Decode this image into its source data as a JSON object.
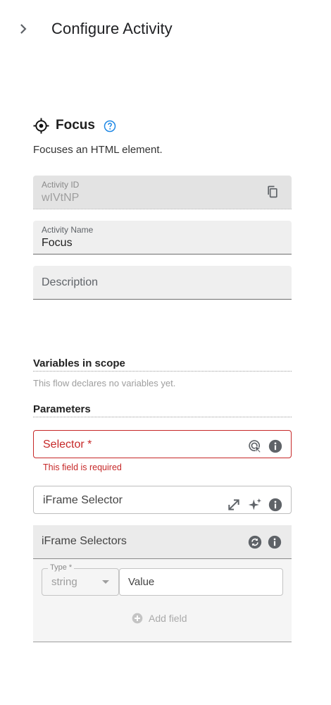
{
  "header": {
    "title": "Configure Activity",
    "back_icon": "chevron-right-icon"
  },
  "activity": {
    "name": "Focus",
    "description": "Focuses an HTML element.",
    "icon": "crosshair-icon"
  },
  "fields": {
    "activity_id": {
      "label": "Activity ID",
      "value": "wIVtNP"
    },
    "activity_name": {
      "label": "Activity Name",
      "value": "Focus"
    },
    "description": {
      "placeholder": "Description"
    }
  },
  "variables": {
    "title": "Variables in scope",
    "empty_text": "This flow declares no variables yet."
  },
  "parameters": {
    "title": "Parameters",
    "selector": {
      "label": "Selector *",
      "error": "This field is required"
    },
    "iframe_selector": {
      "label": "iFrame Selector"
    },
    "iframe_selectors": {
      "title": "iFrame Selectors",
      "type_label": "Type *",
      "type_value": "string",
      "value_placeholder": "Value",
      "add_field": "Add field"
    }
  },
  "colors": {
    "error": "#c62828",
    "accent": "#1e88e5"
  }
}
